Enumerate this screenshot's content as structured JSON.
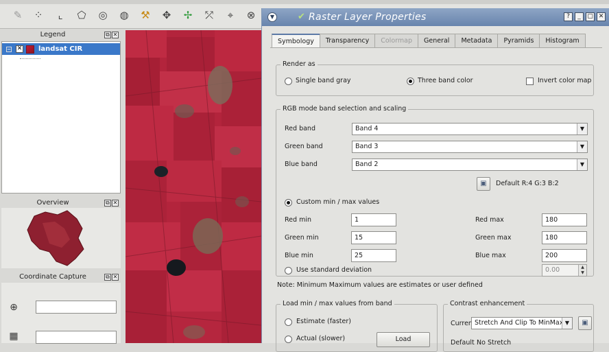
{
  "toolbar": {
    "icons": [
      "pencil-icon",
      "node-icon",
      "vertex-icon",
      "polygon-icon",
      "ring-icon",
      "part-icon",
      "split-icon",
      "move-icon",
      "rotate-icon",
      "reshape-icon",
      "select-icon",
      "delete-icon"
    ]
  },
  "legend": {
    "title": "Legend",
    "layer_name": "landsat CIR",
    "dock_buttons": [
      "⧉",
      "✕"
    ]
  },
  "overview": {
    "title": "Overview"
  },
  "coordinate_capture": {
    "title": "Coordinate Capture"
  },
  "dialog": {
    "title": "Raster Layer Properties",
    "window_buttons": [
      "?",
      "_",
      "▢",
      "✕"
    ],
    "tabs": [
      {
        "label": "Symbology",
        "state": "active"
      },
      {
        "label": "Transparency",
        "state": "normal"
      },
      {
        "label": "Colormap",
        "state": "disabled"
      },
      {
        "label": "General",
        "state": "normal"
      },
      {
        "label": "Metadata",
        "state": "normal"
      },
      {
        "label": "Pyramids",
        "state": "normal"
      },
      {
        "label": "Histogram",
        "state": "normal"
      }
    ],
    "render_as": {
      "title": "Render as",
      "single_band_gray": "Single band gray",
      "three_band_color": "Three band color",
      "invert_color_map": "Invert color map"
    },
    "rgb": {
      "title": "RGB mode band selection and scaling",
      "red_band_label": "Red band",
      "red_band_value": "Band 4",
      "green_band_label": "Green band",
      "green_band_value": "Band 3",
      "blue_band_label": "Blue band",
      "blue_band_value": "Band 2",
      "default_text": "Default R:4 G:3 B:2",
      "custom_minmax": "Custom min / max values",
      "red_min_label": "Red min",
      "red_min": "1",
      "green_min_label": "Green min",
      "green_min": "15",
      "blue_min_label": "Blue min",
      "blue_min": "25",
      "red_max_label": "Red max",
      "red_max": "180",
      "green_max_label": "Green max",
      "green_max": "180",
      "blue_max_label": "Blue max",
      "blue_max": "200",
      "std_dev_label": "Use standard deviation",
      "std_dev_value": "0.00"
    },
    "note": "Note: Minimum Maximum values are estimates or user defined",
    "load_minmax": {
      "title": "Load min / max values from band",
      "estimate": "Estimate (faster)",
      "actual": "Actual (slower)",
      "load_button": "Load"
    },
    "contrast": {
      "title": "Contrast enhancement",
      "current_label": "Current",
      "current_value": "Stretch And Clip To MinMax",
      "default_label": "Default",
      "default_value": "No Stretch"
    }
  }
}
